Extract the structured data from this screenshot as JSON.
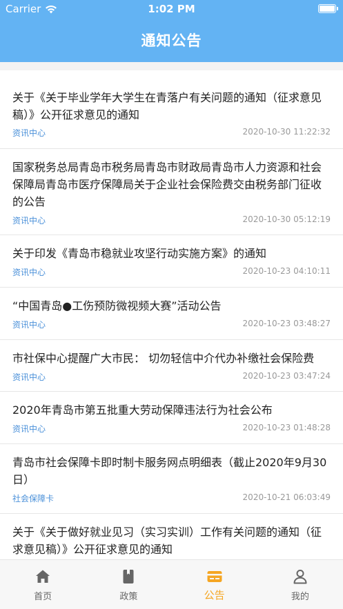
{
  "status_bar": {
    "carrier": "Carrier",
    "time": "1:02 PM"
  },
  "nav": {
    "title": "通知公告"
  },
  "notices": [
    {
      "title": "关于《关于毕业学年大学生在青落户有关问题的通知（征求意见稿）》公开征求意见的通知",
      "source": "资讯中心",
      "time": "2020-10-30 11:22:32"
    },
    {
      "title": "国家税务总局青岛市税务局青岛市财政局青岛市人力资源和社会保障局青岛市医疗保障局关于企业社会保险费交由税务部门征收的公告",
      "source": "资讯中心",
      "time": "2020-10-30 05:12:19"
    },
    {
      "title": "关于印发《青岛市稳就业攻坚行动实施方案》的通知",
      "source": "资讯中心",
      "time": "2020-10-23 04:10:11"
    },
    {
      "title": "“中国青岛●工伤预防微视频大赛”活动公告",
      "source": "资讯中心",
      "time": "2020-10-23 03:48:27"
    },
    {
      "title": "市社保中心提醒广大市民： 切勿轻信中介代办补缴社会保险费",
      "source": "资讯中心",
      "time": "2020-10-23 03:47:24"
    },
    {
      "title": "2020年青岛市第五批重大劳动保障违法行为社会公布",
      "source": "资讯中心",
      "time": "2020-10-23 01:48:28"
    },
    {
      "title": "青岛市社会保障卡即时制卡服务网点明细表（截止2020年9月30日）",
      "source": "社会保障卡",
      "time": "2020-10-21 06:03:49"
    },
    {
      "title": "关于《关于做好就业见习（实习实训）工作有关问题的通知（征求意见稿）》公开征求意见的通知",
      "source": "",
      "time": ""
    }
  ],
  "tabs": [
    {
      "label": "首页",
      "icon": "home-icon"
    },
    {
      "label": "政策",
      "icon": "book-icon"
    },
    {
      "label": "公告",
      "icon": "card-icon",
      "active": true
    },
    {
      "label": "我的",
      "icon": "user-icon"
    }
  ],
  "colors": {
    "header": "#63b3f3",
    "active_tab": "#f5a623",
    "source_text": "#4a90d9",
    "time_text": "#999999"
  }
}
